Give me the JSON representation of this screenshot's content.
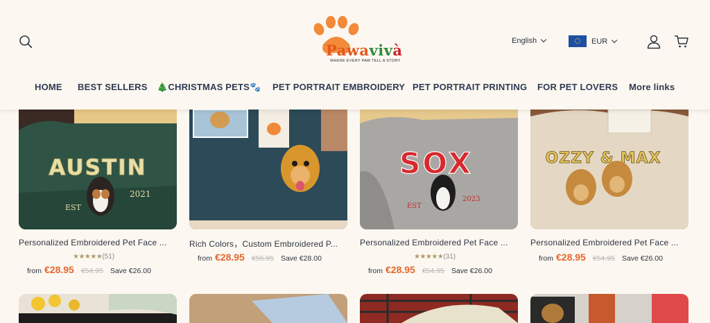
{
  "header": {
    "logo": {
      "name_parts": [
        "P",
        "awa",
        "viv",
        "à"
      ],
      "tagline": "WHERE EVERY PAW TELL A STORY"
    },
    "language": "English",
    "currency": "EUR",
    "icons": {
      "search": "search-icon",
      "account": "user-icon",
      "cart": "cart-icon",
      "flag": "eu-flag-icon"
    }
  },
  "nav": {
    "items": [
      {
        "label": "HOME"
      },
      {
        "label": "BEST SELLERS"
      },
      {
        "label": "🎄CHRISTMAS PETS🐾"
      },
      {
        "label": "PET PORTRAIT EMBROIDERY"
      },
      {
        "label": "PET PORTRAIT PRINTING"
      },
      {
        "label": "FOR PET LOVERS"
      },
      {
        "label": "More links"
      }
    ]
  },
  "products": [
    {
      "title": "Personalized Embroidered Pet Face ...",
      "stars": "★★★★★",
      "reviews": "(51)",
      "from": "from",
      "price": "€28.95",
      "compare": "€54.95",
      "save": "Save €26.00",
      "image_text": [
        "AUSTIN",
        "2021",
        "EST"
      ]
    },
    {
      "title": "Rich Colors，Custom Embroidered P...",
      "stars": "",
      "reviews": "",
      "from": "from",
      "price": "€28.95",
      "compare": "€56.95",
      "save": "Save €28.00",
      "image_text": []
    },
    {
      "title": "Personalized Embroidered Pet Face ...",
      "stars": "★★★★★",
      "reviews": "(31)",
      "from": "from",
      "price": "€28.95",
      "compare": "€54.95",
      "save": "Save €26.00",
      "image_text": [
        "SOX",
        "2023",
        "EST"
      ]
    },
    {
      "title": "Personalized Embroidered Pet Face ...",
      "stars": "",
      "reviews": "",
      "from": "from",
      "price": "€28.95",
      "compare": "€54.95",
      "save": "Save €26.00",
      "image_text": [
        "OZZY & MAX"
      ]
    }
  ],
  "colors": {
    "background": "#fcf8f1",
    "price_accent": "#e5662e",
    "nav_text": "#2f3a53"
  }
}
